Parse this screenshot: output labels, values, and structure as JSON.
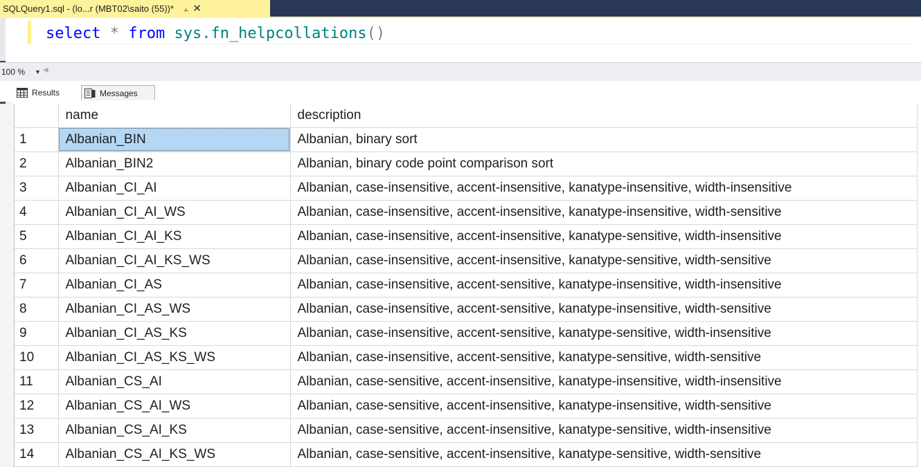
{
  "tab": {
    "title": "SQLQuery1.sql - (lo...r (MBT02\\saito (55))*",
    "pin_icon": "pin-icon",
    "close_icon": "close-icon"
  },
  "editor": {
    "kw1": "select",
    "star": "*",
    "kw2": "from",
    "fn": "sys.fn_helpcollations",
    "parens": "()"
  },
  "zoom": {
    "value": "100 %"
  },
  "results_tabs": {
    "results_label": "Results",
    "messages_label": "Messages"
  },
  "grid": {
    "columns": [
      "name",
      "description"
    ],
    "rows": [
      {
        "n": "1",
        "name": "Albanian_BIN",
        "description": "Albanian, binary sort"
      },
      {
        "n": "2",
        "name": "Albanian_BIN2",
        "description": "Albanian, binary code point comparison sort"
      },
      {
        "n": "3",
        "name": "Albanian_CI_AI",
        "description": "Albanian, case-insensitive, accent-insensitive, kanatype-insensitive, width-insensitive"
      },
      {
        "n": "4",
        "name": "Albanian_CI_AI_WS",
        "description": "Albanian, case-insensitive, accent-insensitive, kanatype-insensitive, width-sensitive"
      },
      {
        "n": "5",
        "name": "Albanian_CI_AI_KS",
        "description": "Albanian, case-insensitive, accent-insensitive, kanatype-sensitive, width-insensitive"
      },
      {
        "n": "6",
        "name": "Albanian_CI_AI_KS_WS",
        "description": "Albanian, case-insensitive, accent-insensitive, kanatype-sensitive, width-sensitive"
      },
      {
        "n": "7",
        "name": "Albanian_CI_AS",
        "description": "Albanian, case-insensitive, accent-sensitive, kanatype-insensitive, width-insensitive"
      },
      {
        "n": "8",
        "name": "Albanian_CI_AS_WS",
        "description": "Albanian, case-insensitive, accent-sensitive, kanatype-insensitive, width-sensitive"
      },
      {
        "n": "9",
        "name": "Albanian_CI_AS_KS",
        "description": "Albanian, case-insensitive, accent-sensitive, kanatype-sensitive, width-insensitive"
      },
      {
        "n": "10",
        "name": "Albanian_CI_AS_KS_WS",
        "description": "Albanian, case-insensitive, accent-sensitive, kanatype-sensitive, width-sensitive"
      },
      {
        "n": "11",
        "name": "Albanian_CS_AI",
        "description": "Albanian, case-sensitive, accent-insensitive, kanatype-insensitive, width-insensitive"
      },
      {
        "n": "12",
        "name": "Albanian_CS_AI_WS",
        "description": "Albanian, case-sensitive, accent-insensitive, kanatype-insensitive, width-sensitive"
      },
      {
        "n": "13",
        "name": "Albanian_CS_AI_KS",
        "description": "Albanian, case-sensitive, accent-insensitive, kanatype-sensitive, width-insensitive"
      },
      {
        "n": "14",
        "name": "Albanian_CS_AI_KS_WS",
        "description": "Albanian, case-sensitive, accent-insensitive, kanatype-sensitive, width-sensitive"
      }
    ]
  },
  "colors": {
    "tab_active": "#fff29d",
    "tab_strip": "#293955",
    "selection": "#b4d7f4",
    "keyword": "#0000ff",
    "function": "#008080"
  }
}
